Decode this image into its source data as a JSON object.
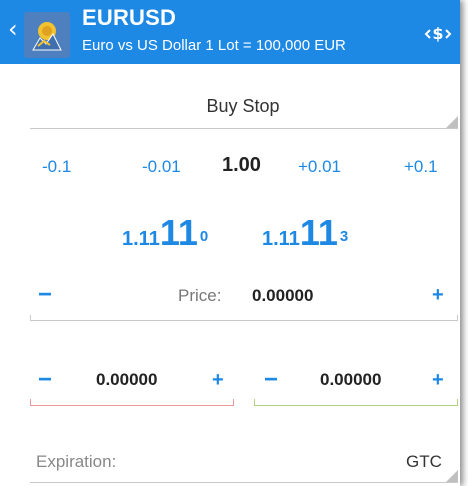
{
  "header": {
    "symbol": "EURUSD",
    "description": "Euro vs US Dollar 1 Lot = 100,000 EUR",
    "back_icon": "chevron-left-icon",
    "logo_icon": "metatrader-logo-icon",
    "toggle_icon": "swap-currency-icon"
  },
  "order_type": {
    "value": "Buy Stop"
  },
  "volume": {
    "decrease_large": "-0.1",
    "decrease_small": "-0.01",
    "current": "1.00",
    "increase_small": "+0.01",
    "increase_large": "+0.1"
  },
  "quotes": {
    "bid": {
      "prefix": "1.11",
      "big": "11",
      "sup": "0"
    },
    "ask": {
      "prefix": "1.11",
      "big": "11",
      "sup": "3"
    }
  },
  "price_field": {
    "minus": "−",
    "plus": "+",
    "label": "Price:",
    "value": "0.00000"
  },
  "stop_loss": {
    "minus": "−",
    "plus": "+",
    "value": "0.00000"
  },
  "take_profit": {
    "minus": "−",
    "plus": "+",
    "value": "0.00000"
  },
  "expiration": {
    "label": "Expiration:",
    "value": "GTC"
  },
  "colors": {
    "accent": "#1e88e5",
    "stop_loss_line": "#ef9a9a",
    "take_profit_line": "#aed581"
  }
}
